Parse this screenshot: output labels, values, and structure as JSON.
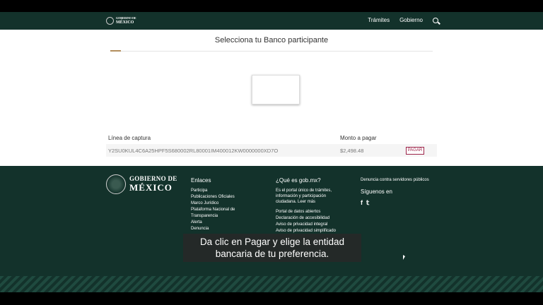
{
  "header": {
    "logo_line1": "GOBIERNO DE",
    "logo_line2": "MÉXICO",
    "nav": [
      "Trámites",
      "Gobierno"
    ]
  },
  "main": {
    "title": "Selecciona tu Banco participante",
    "table": {
      "col_capture": "Línea de captura",
      "col_amount": "Monto a pagar",
      "capture_value": "Y2SU0KUL4C6A25HPF5S680002RL80001IM400012KW0000000XD7O",
      "amount_value": "$2,498.48",
      "pay_label": "PAGAR"
    }
  },
  "footer": {
    "logo_line1": "GOBIERNO DE",
    "logo_line2": "MÉXICO",
    "links_title": "Enlaces",
    "links": [
      "Participa",
      "Publicaciones Oficiales",
      "Marco Jurídico",
      "Plataforma Nacional de",
      "Transparencia",
      "Alerta",
      "Denuncia"
    ],
    "about_title": "¿Qué es gob.mx?",
    "about_text": "Es el portal único de trámites, información y participación ciudadana. Leer más",
    "about_links": [
      "Portal de datos abiertos",
      "Declaración de accesibilidad",
      "Aviso de privacidad integral",
      "Aviso de privacidad simplificado"
    ],
    "denuncia": "Denuncia contra servidores públicos",
    "social_title": "Síguenos en",
    "social_f": "f",
    "social_t": "𝕥"
  },
  "subtitle": {
    "line1": "Da clic en Pagar y elige la entidad",
    "line2": "bancaria de tu preferencia."
  }
}
